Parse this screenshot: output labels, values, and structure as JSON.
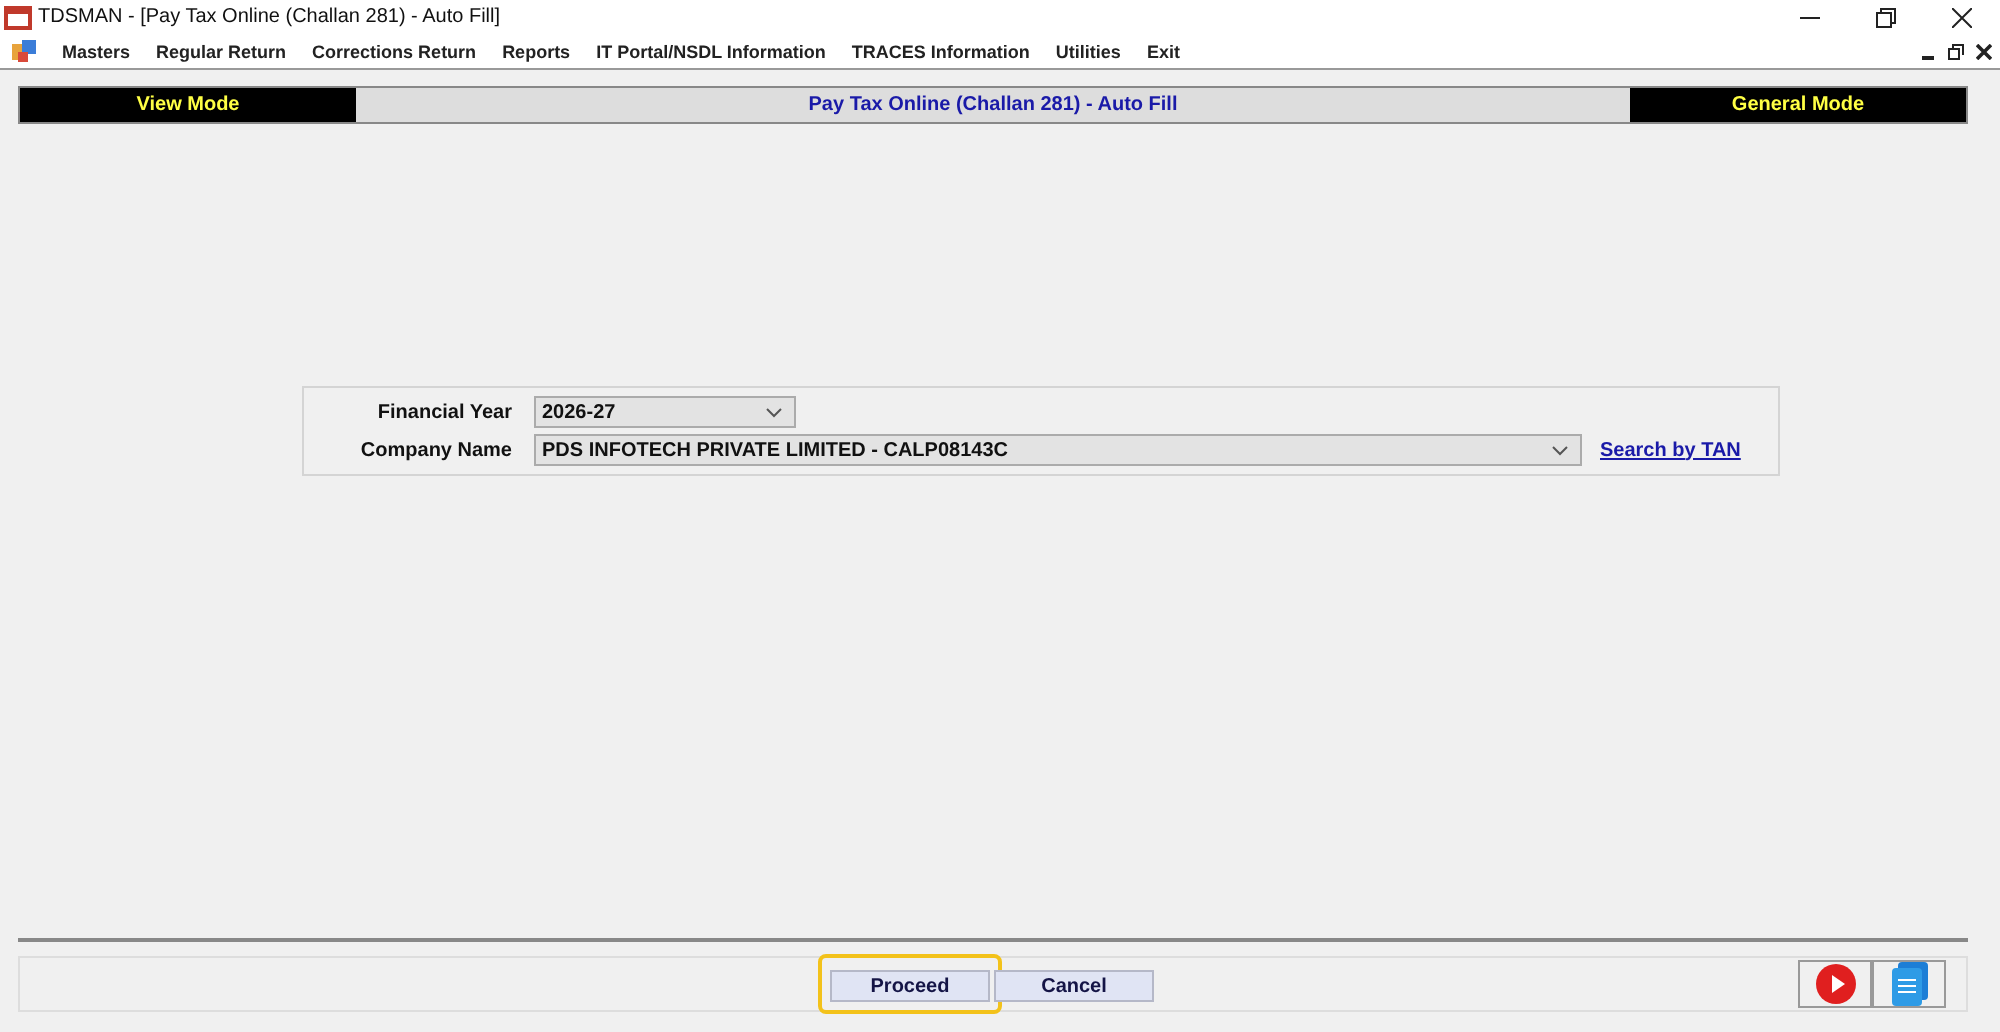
{
  "window": {
    "title": "TDSMAN - [Pay Tax Online (Challan 281) - Auto Fill]"
  },
  "menu": [
    "Masters",
    "Regular Return",
    "Corrections Return",
    "Reports",
    "IT Portal/NSDL Information",
    "TRACES Information",
    "Utilities",
    "Exit"
  ],
  "header": {
    "left": "View Mode",
    "center": "Pay Tax Online (Challan 281) - Auto Fill",
    "right": "General Mode"
  },
  "form": {
    "fields": [
      {
        "label": "Financial Year",
        "value": "2026-27",
        "kind": "short"
      },
      {
        "label": "Company Name",
        "value": "PDS INFOTECH PRIVATE LIMITED - CALP08143C",
        "kind": "long"
      }
    ],
    "link": "Search by TAN"
  },
  "buttons": [
    {
      "label": "Proceed",
      "highlighted": true
    },
    {
      "label": "Cancel",
      "highlighted": false
    }
  ]
}
